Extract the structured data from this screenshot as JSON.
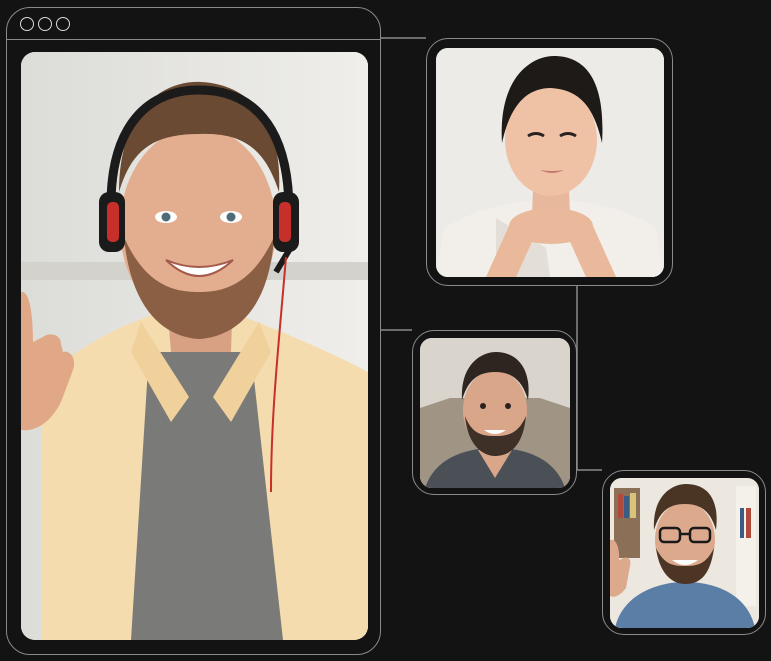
{
  "window": {
    "controls": [
      "close-control",
      "minimize-control",
      "maximize-control"
    ]
  },
  "main_speaker": {
    "icon": "man-with-headset-waving",
    "colors": {
      "shirt": "#f6ddb0",
      "tshirt": "#7b7b79",
      "hair": "#6b4a33",
      "background": "#e9e8e4"
    }
  },
  "participants": [
    {
      "id": "participant-1",
      "icon": "woman-hands-folded",
      "colors": {
        "hair": "#1e1a18",
        "blouse": "#f2eeea"
      }
    },
    {
      "id": "participant-2",
      "icon": "smiling-bearded-man",
      "colors": {
        "hair": "#2e2520",
        "shirt": "#4b4f56"
      }
    },
    {
      "id": "participant-3",
      "icon": "man-with-glasses-waving",
      "colors": {
        "hair": "#4a3525",
        "shirt": "#5b7ea6"
      }
    }
  ],
  "theme": {
    "background": "#131313",
    "border": "#8a8a8a"
  }
}
